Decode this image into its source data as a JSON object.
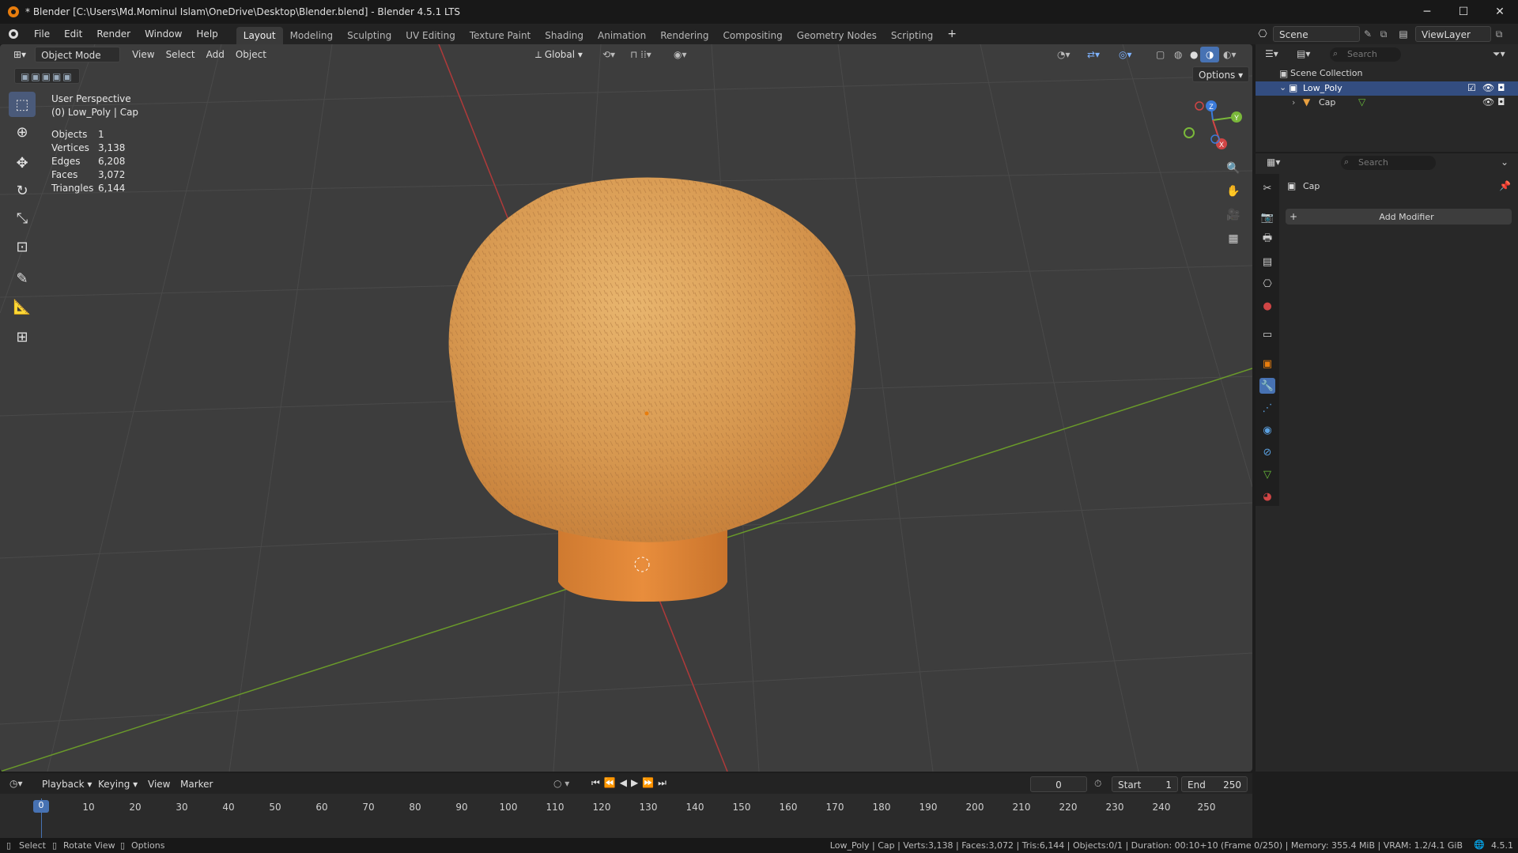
{
  "window": {
    "title": "* Blender [C:\\Users\\Md.Mominul Islam\\OneDrive\\Desktop\\Blender.blend] - Blender 4.5.1 LTS",
    "minimize": "─",
    "maximize": "☐",
    "close": "✕"
  },
  "menu": [
    "File",
    "Edit",
    "Render",
    "Window",
    "Help"
  ],
  "workspaces": [
    "Layout",
    "Modeling",
    "Sculpting",
    "UV Editing",
    "Texture Paint",
    "Shading",
    "Animation",
    "Rendering",
    "Compositing",
    "Geometry Nodes",
    "Scripting"
  ],
  "workspace_add": "+",
  "scene": {
    "label": "Scene",
    "viewlayer": "ViewLayer"
  },
  "viewport_header": {
    "mode": "Object Mode",
    "menus": [
      "View",
      "Select",
      "Add",
      "Object"
    ],
    "orientation": "Global",
    "options": "Options"
  },
  "overlay_info": {
    "perspective": "User Perspective",
    "object": "(0) Low_Poly | Cap"
  },
  "stats": [
    {
      "label": "Objects",
      "value": "1"
    },
    {
      "label": "Vertices",
      "value": "3,138"
    },
    {
      "label": "Edges",
      "value": "6,208"
    },
    {
      "label": "Faces",
      "value": "3,072"
    },
    {
      "label": "Triangles",
      "value": "6,144"
    }
  ],
  "gizmo": {
    "z": "Z",
    "y": "Y",
    "x": "X"
  },
  "outliner": {
    "search_placeholder": "Search",
    "scene_collection": "Scene Collection",
    "collection": "Low_Poly",
    "object": "Cap"
  },
  "properties": {
    "search_placeholder": "Search",
    "object_name": "Cap",
    "add_modifier": "Add Modifier",
    "add_icon": "+"
  },
  "timeline": {
    "menus": [
      "Playback",
      "Keying",
      "View",
      "Marker"
    ],
    "current_frame": "0",
    "start_label": "Start",
    "start": "1",
    "end_label": "End",
    "end": "250",
    "ticks": [
      "0",
      "10",
      "20",
      "30",
      "40",
      "50",
      "60",
      "70",
      "80",
      "90",
      "100",
      "110",
      "120",
      "130",
      "140",
      "150",
      "160",
      "170",
      "180",
      "190",
      "200",
      "210",
      "220",
      "230",
      "240",
      "250"
    ]
  },
  "statusbar": {
    "select": "Select",
    "rotate": "Rotate View",
    "options": "Options",
    "info": "Low_Poly | Cap | Verts:3,138 | Faces:3,072 | Tris:6,144 | Objects:0/1 | Duration: 00:10+10 (Frame 0/250) | Memory: 355.4 MiB | VRAM: 1.2/4.1 GiB",
    "version": "4.5.1"
  },
  "colors": {
    "accent": "#4772b3",
    "viewport_bg": "#3d3d3d",
    "cap_top": "#e0a860",
    "cap_stem": "#e08a3a",
    "x_axis": "#b03a3a",
    "y_axis": "#6a9a2a"
  }
}
